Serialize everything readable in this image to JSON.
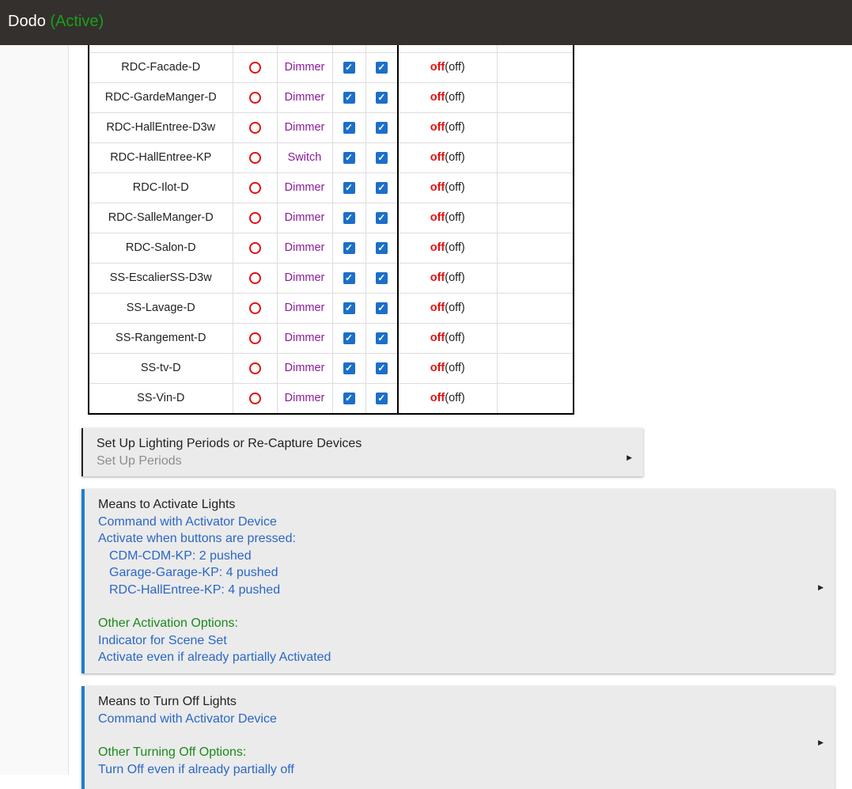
{
  "header": {
    "app_name": "Dodo",
    "status": "(Active)"
  },
  "devices": [
    {
      "name": "RDC-Facade-D",
      "type": "Dimmer",
      "state": "off",
      "state_paren": "(off)"
    },
    {
      "name": "RDC-GardeManger-D",
      "type": "Dimmer",
      "state": "off",
      "state_paren": "(off)"
    },
    {
      "name": "RDC-HallEntree-D3w",
      "type": "Dimmer",
      "state": "off",
      "state_paren": "(off)"
    },
    {
      "name": "RDC-HallEntree-KP",
      "type": "Switch",
      "state": "off",
      "state_paren": "(off)"
    },
    {
      "name": "RDC-Ilot-D",
      "type": "Dimmer",
      "state": "off",
      "state_paren": "(off)"
    },
    {
      "name": "RDC-SalleManger-D",
      "type": "Dimmer",
      "state": "off",
      "state_paren": "(off)"
    },
    {
      "name": "RDC-Salon-D",
      "type": "Dimmer",
      "state": "off",
      "state_paren": "(off)"
    },
    {
      "name": "SS-EscalierSS-D3w",
      "type": "Dimmer",
      "state": "off",
      "state_paren": "(off)"
    },
    {
      "name": "SS-Lavage-D",
      "type": "Dimmer",
      "state": "off",
      "state_paren": "(off)"
    },
    {
      "name": "SS-Rangement-D",
      "type": "Dimmer",
      "state": "off",
      "state_paren": "(off)"
    },
    {
      "name": "SS-tv-D",
      "type": "Dimmer",
      "state": "off",
      "state_paren": "(off)"
    },
    {
      "name": "SS-Vin-D",
      "type": "Dimmer",
      "state": "off",
      "state_paren": "(off)"
    }
  ],
  "periods_section": {
    "title": "Set Up Lighting Periods or Re-Capture Devices",
    "subtitle": "Set Up Periods",
    "arrow": "▶"
  },
  "activate_section": {
    "title": "Means to Activate Lights",
    "command": "Command with Activator Device",
    "buttons_header": "Activate when buttons are pressed:",
    "buttons": [
      "CDM-CDM-KP: 2 pushed",
      "Garage-Garage-KP: 4 pushed",
      "RDC-HallEntree-KP: 4 pushed"
    ],
    "other_header": "Other Activation Options:",
    "options": [
      "Indicator for Scene Set",
      "Activate even if already partially Activated"
    ],
    "arrow": "▶"
  },
  "turnoff_section": {
    "title": "Means to Turn Off Lights",
    "command": "Command with Activator Device",
    "other_header": "Other Turning Off Options:",
    "options": [
      "Turn Off even if already partially off"
    ],
    "arrow": "▶"
  },
  "icons": {
    "indicator": "red-ring-icon",
    "checkbox": "checkbox-checked-icon",
    "expand": "triangle-right-icon"
  },
  "colors": {
    "header_bg": "#34302d",
    "active": "#1aa01a",
    "dimmer": "#8b1a9b",
    "off": "#e01010",
    "link": "#2b67c6",
    "green": "#1a8a1a",
    "accent": "#1f7fd1"
  }
}
